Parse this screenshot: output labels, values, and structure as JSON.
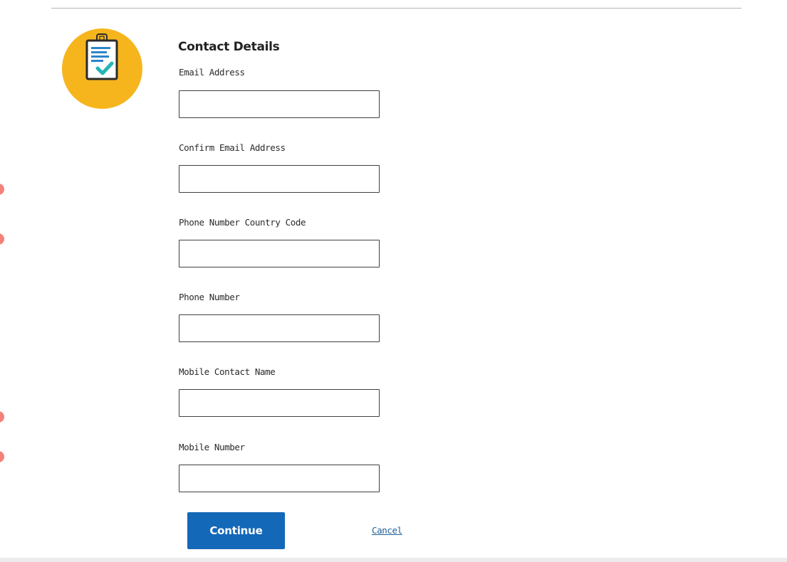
{
  "section": {
    "title": "Contact Details"
  },
  "fields": [
    {
      "label": "Email Address",
      "value": ""
    },
    {
      "label": "Confirm Email Address",
      "value": ""
    },
    {
      "label": "Phone Number Country Code",
      "value": ""
    },
    {
      "label": "Phone Number",
      "value": ""
    },
    {
      "label": "Mobile Contact Name",
      "value": ""
    },
    {
      "label": "Mobile Number",
      "value": ""
    }
  ],
  "actions": {
    "continue_label": "Continue",
    "cancel_label": "Cancel"
  },
  "icons": {
    "badge": "clipboard-check-icon"
  },
  "colors": {
    "badge": "#f6b51d",
    "primary_button": "#1468b8",
    "link": "#1f5f96",
    "checkmark": "#27b5b5",
    "side_decoration": "#f26b63"
  }
}
